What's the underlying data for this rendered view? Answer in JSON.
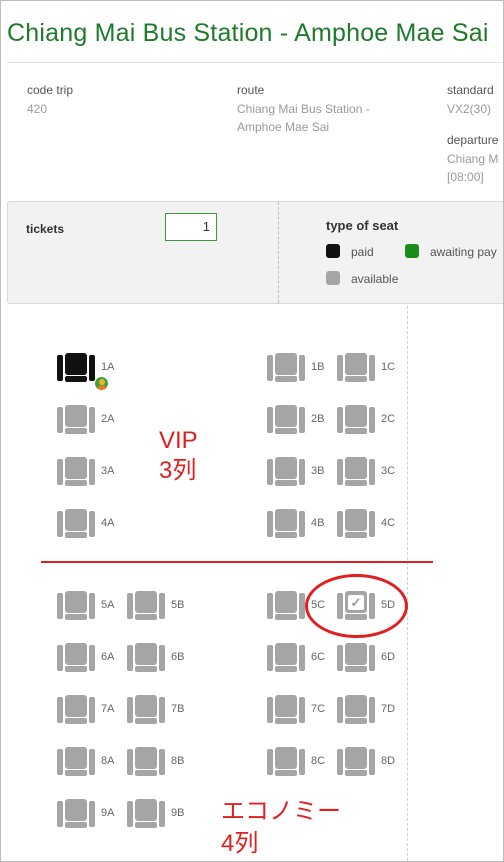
{
  "header": {
    "title": "Chiang Mai Bus Station - Amphoe Mae Sai"
  },
  "trip": {
    "code_label": "code trip",
    "code_value": "420",
    "route_label": "route",
    "route_value_1": "Chiang Mai Bus Station -",
    "route_value_2": "Amphoe Mae Sai",
    "standard_label": "standard",
    "standard_value": "VX2(30)",
    "departure_label": "departure",
    "departure_value_1": "Chiang M",
    "departure_value_2": "[08:00]"
  },
  "panel": {
    "tickets_label": "tickets",
    "tickets_value": "1",
    "seat_type_title": "type of seat",
    "legend": [
      {
        "label": "paid",
        "color": "#111111"
      },
      {
        "label": "awaiting pay",
        "color": "#1a8c1a"
      },
      {
        "label": "available",
        "color": "#a5a5a5"
      }
    ]
  },
  "seats": [
    {
      "label": "1A",
      "status": "paid",
      "col": 0,
      "row": 0
    },
    {
      "label": "1B",
      "status": "available",
      "col": 2,
      "row": 0
    },
    {
      "label": "1C",
      "status": "available",
      "col": 3,
      "row": 0
    },
    {
      "label": "2A",
      "status": "available",
      "col": 0,
      "row": 1
    },
    {
      "label": "2B",
      "status": "available",
      "col": 2,
      "row": 1
    },
    {
      "label": "2C",
      "status": "available",
      "col": 3,
      "row": 1
    },
    {
      "label": "3A",
      "status": "available",
      "col": 0,
      "row": 2
    },
    {
      "label": "3B",
      "status": "available",
      "col": 2,
      "row": 2
    },
    {
      "label": "3C",
      "status": "available",
      "col": 3,
      "row": 2
    },
    {
      "label": "4A",
      "status": "available",
      "col": 0,
      "row": 3
    },
    {
      "label": "4B",
      "status": "available",
      "col": 2,
      "row": 3
    },
    {
      "label": "4C",
      "status": "available",
      "col": 3,
      "row": 3
    },
    {
      "label": "5A",
      "status": "available",
      "col": 0,
      "row": 4
    },
    {
      "label": "5B",
      "status": "available",
      "col": 1,
      "row": 4
    },
    {
      "label": "5C",
      "status": "available",
      "col": 2,
      "row": 4
    },
    {
      "label": "5D",
      "status": "selected",
      "col": 3,
      "row": 4
    },
    {
      "label": "6A",
      "status": "available",
      "col": 0,
      "row": 5
    },
    {
      "label": "6B",
      "status": "available",
      "col": 1,
      "row": 5
    },
    {
      "label": "6C",
      "status": "available",
      "col": 2,
      "row": 5
    },
    {
      "label": "6D",
      "status": "available",
      "col": 3,
      "row": 5
    },
    {
      "label": "7A",
      "status": "available",
      "col": 0,
      "row": 6
    },
    {
      "label": "7B",
      "status": "available",
      "col": 1,
      "row": 6
    },
    {
      "label": "7C",
      "status": "available",
      "col": 2,
      "row": 6
    },
    {
      "label": "7D",
      "status": "available",
      "col": 3,
      "row": 6
    },
    {
      "label": "8A",
      "status": "available",
      "col": 0,
      "row": 7
    },
    {
      "label": "8B",
      "status": "available",
      "col": 1,
      "row": 7
    },
    {
      "label": "8C",
      "status": "available",
      "col": 2,
      "row": 7
    },
    {
      "label": "8D",
      "status": "available",
      "col": 3,
      "row": 7
    },
    {
      "label": "9A",
      "status": "available",
      "col": 0,
      "row": 8
    },
    {
      "label": "9B",
      "status": "available",
      "col": 1,
      "row": 8
    }
  ],
  "annotations": {
    "vip_line1": "VIP",
    "vip_line2": "3列",
    "economy_line1": "エコノミー",
    "economy_line2": "4列",
    "color": "#e02020"
  },
  "icons": {
    "checkmark": "✓",
    "passenger_badge": "person-icon"
  }
}
